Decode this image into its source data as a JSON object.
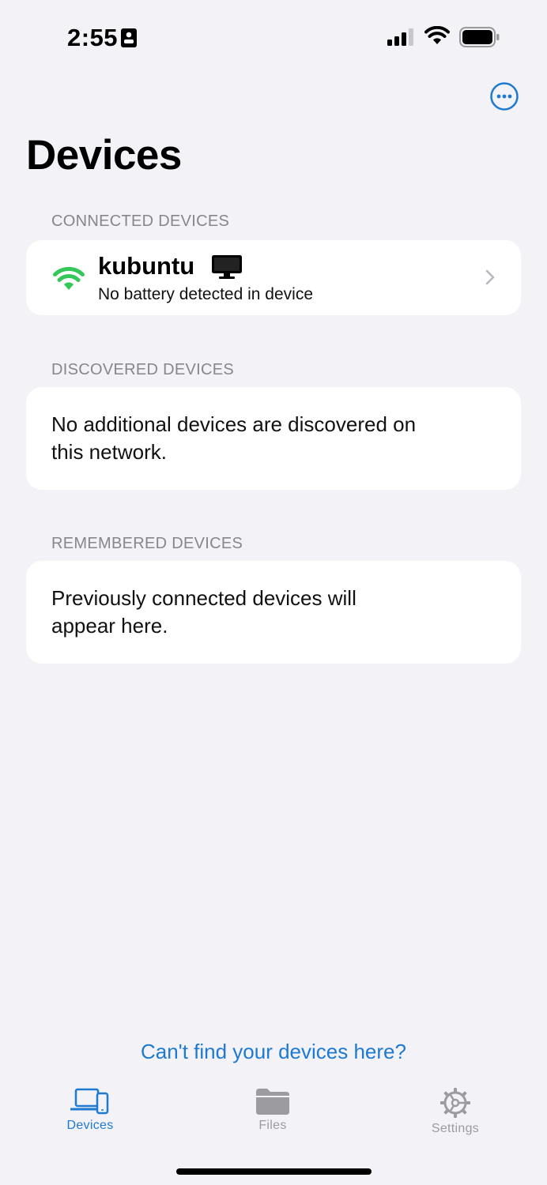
{
  "status_bar": {
    "time": "2:55",
    "icons": [
      "id-card-icon",
      "cellular-signal-icon",
      "wifi-icon",
      "battery-icon"
    ]
  },
  "header": {
    "title": "Devices",
    "more_icon": "ellipsis-circle-icon"
  },
  "sections": {
    "connected": {
      "header": "CONNECTED DEVICES",
      "devices": [
        {
          "name": "kubuntu",
          "status": "No battery detected in device",
          "connection_icon": "wifi-icon",
          "type_icon": "desktop-monitor-icon"
        }
      ]
    },
    "discovered": {
      "header": "DISCOVERED DEVICES",
      "empty_line1": "No additional devices are discovered on",
      "empty_line2": "this network."
    },
    "remembered": {
      "header": "REMEMBERED DEVICES",
      "empty_line1": "Previously connected devices will",
      "empty_line2": "appear here."
    }
  },
  "help_link": "Can't find your devices here?",
  "tab_bar": {
    "selected": "Devices",
    "tabs": [
      {
        "label": "Devices",
        "icon": "devices-icon"
      },
      {
        "label": "Files",
        "icon": "folder-icon"
      },
      {
        "label": "Settings",
        "icon": "gear-icon"
      }
    ]
  },
  "colors": {
    "accent": "#1e79d0",
    "connected_green": "#34c759",
    "background": "#f2f2f7",
    "inactive_tab": "#9b9ba0"
  }
}
